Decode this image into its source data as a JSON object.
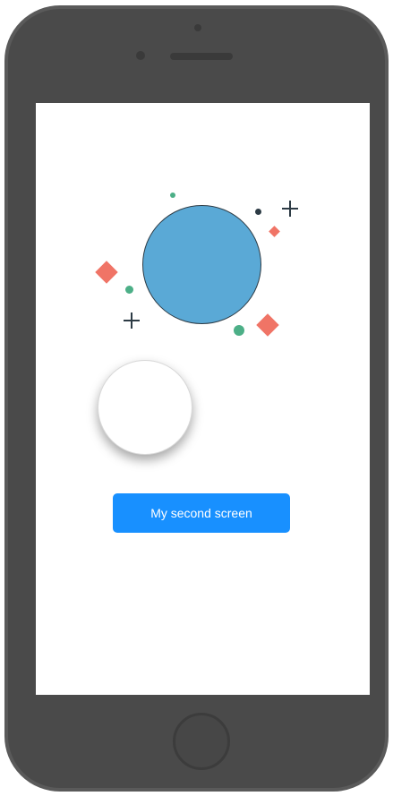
{
  "screen": {
    "button_label": "My second screen"
  },
  "colors": {
    "planet": "#5aa9d6",
    "accent_diamond": "#f07466",
    "accent_dot": "#4caf87",
    "button": "#1890ff",
    "frame": "#4a4a4a"
  }
}
